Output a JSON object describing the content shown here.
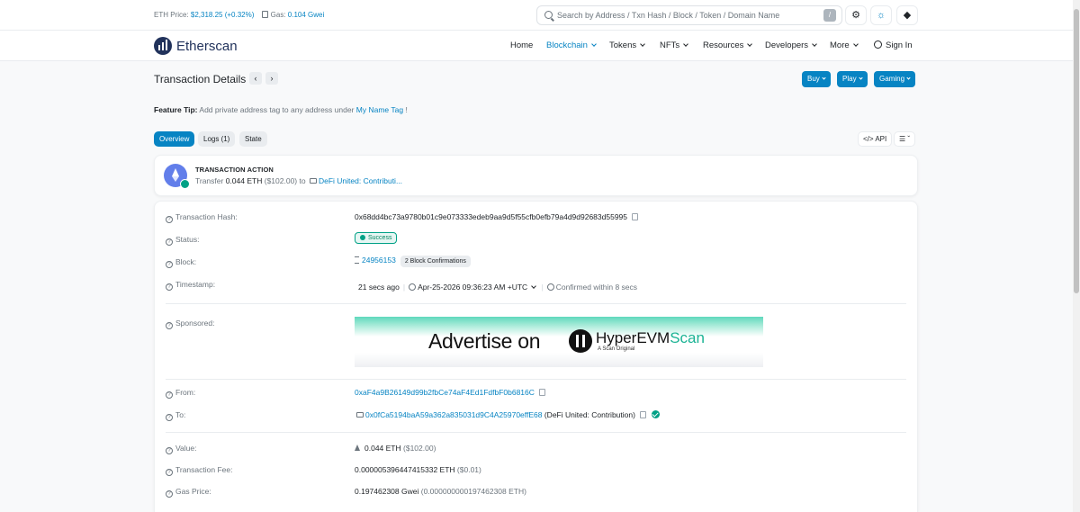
{
  "topbar": {
    "eth_price_label": "ETH Price:",
    "eth_price_value": "$2,318.25 (+0.32%)",
    "gas_label": "Gas:",
    "gas_value": "0.104 Gwei",
    "search_placeholder": "Search by Address / Txn Hash / Block / Token / Domain Name",
    "search_shortcut": "/",
    "icons": [
      "gear-icon",
      "sun-icon",
      "ethereum-icon"
    ]
  },
  "navbar": {
    "brand": "Etherscan",
    "items": [
      {
        "label": "Home",
        "dropdown": false,
        "active": false
      },
      {
        "label": "Blockchain",
        "dropdown": true,
        "active": true
      },
      {
        "label": "Tokens",
        "dropdown": true,
        "active": false
      },
      {
        "label": "NFTs",
        "dropdown": true,
        "active": false
      },
      {
        "label": "Resources",
        "dropdown": true,
        "active": false
      },
      {
        "label": "Developers",
        "dropdown": true,
        "active": false
      },
      {
        "label": "More",
        "dropdown": true,
        "active": false
      }
    ],
    "signin": "Sign In"
  },
  "page": {
    "title": "Transaction Details",
    "buttons": [
      "Buy",
      "Play",
      "Gaming"
    ],
    "feature_tip_label": "Feature Tip:",
    "feature_tip_text": "Add private address tag to any address under",
    "feature_tip_link": "My Name Tag",
    "feature_tip_end": "!"
  },
  "tabs": [
    {
      "label": "Overview",
      "active": true
    },
    {
      "label": "Logs (1)",
      "active": false
    },
    {
      "label": "State",
      "active": false
    }
  ],
  "api_button": "</> API",
  "action": {
    "label": "TRANSACTION ACTION",
    "prefix": "Transfer",
    "amount": "0.044 ETH",
    "usd": "($102.00)",
    "to_word": "to",
    "to_name": "DeFi United: Contributi..."
  },
  "details": {
    "hash_label": "Transaction Hash:",
    "hash": "0x68dd4bc73a9780b01c9e073333edeb9aa9d5f55cfb0efb79a4d9d92683d55995",
    "status_label": "Status:",
    "status": "Success",
    "block_label": "Block:",
    "block": "24956153",
    "confirmations": "2 Block Confirmations",
    "timestamp_label": "Timestamp:",
    "timestamp_ago": "21 secs ago",
    "timestamp": "Apr-25-2026 09:36:23 AM +UTC",
    "confirmed_within": "Confirmed within 8 secs",
    "sponsored_label": "Sponsored:",
    "ad_text": "Advertise on",
    "ad_brand_main": "HyperEVM",
    "ad_brand_accent": "Scan",
    "ad_sub": "A Scan Original",
    "from_label": "From:",
    "from": "0xaF4a9B26149d99b2fbCe74aF4Ed1FdfbF0b6816C",
    "to_label": "To:",
    "to": "0x0fCa5194baA59a362a835031d9C4A25970effE68",
    "to_name": "(DeFi United: Contribution)",
    "value_label": "Value:",
    "value": "0.044 ETH",
    "value_usd": "($102.00)",
    "fee_label": "Transaction Fee:",
    "fee": "0.000005396447415332 ETH",
    "fee_usd": "($0.01)",
    "gas_price_label": "Gas Price:",
    "gas_price": "0.197462308 Gwei",
    "gas_price_eth": "(0.000000000197462308 ETH)"
  }
}
